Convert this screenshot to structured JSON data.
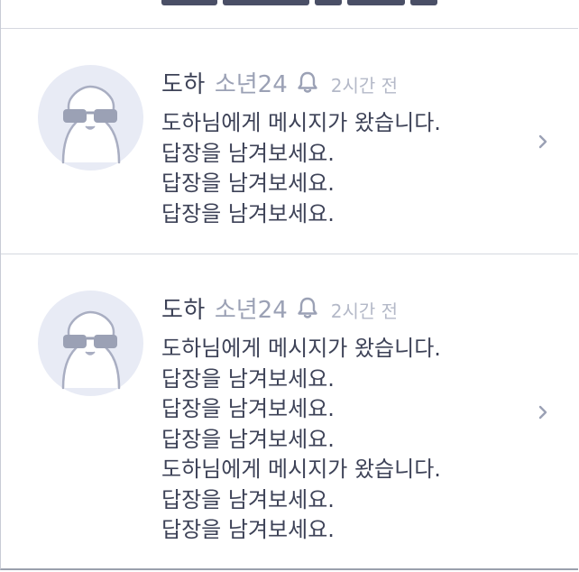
{
  "icons": {
    "bell": "bell-icon",
    "chevron": "chevron-right-icon",
    "avatar": "sunglasses-character-avatar"
  },
  "colors": {
    "name": "#3d4257",
    "nickname": "#9ba1b5",
    "time": "#b4b9c8",
    "avatar_bg": "#e8ebf5",
    "divider": "#d5d8e0"
  },
  "notifications": [
    {
      "name": "도하",
      "nickname": "소년24",
      "time": "2시간 전",
      "lines": [
        "도하님에게 메시지가 왔습니다.",
        "답장을 남겨보세요.",
        "답장을 남겨보세요.",
        "답장을 남겨보세요."
      ]
    },
    {
      "name": "도하",
      "nickname": "소년24",
      "time": "2시간 전",
      "lines": [
        "도하님에게 메시지가 왔습니다.",
        "답장을 남겨보세요.",
        "답장을 남겨보세요.",
        "답장을 남겨보세요.",
        "도하님에게 메시지가 왔습니다.",
        "답장을 남겨보세요.",
        "답장을 남겨보세요."
      ]
    }
  ]
}
